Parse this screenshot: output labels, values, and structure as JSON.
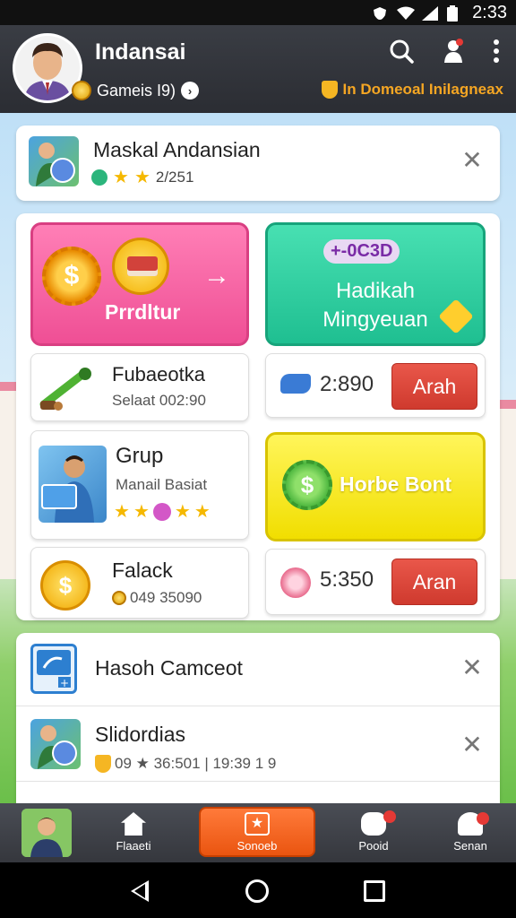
{
  "status_bar": {
    "time": "2:33"
  },
  "header": {
    "title": "Indansai",
    "subtitle": "Gameis I9)",
    "link": "In Domeoal Inilagneax"
  },
  "card1": {
    "title": "Maskal Andansian",
    "meta": "2/251"
  },
  "tiles": {
    "pink_label": "Prrdltur",
    "teal_code": "+-0C3D",
    "teal_label_1": "Hadikah",
    "teal_label_2": "Mingyeuan",
    "yellow_label": "Horbe Bont"
  },
  "rows": {
    "fubaeotka_title": "Fubaeotka",
    "fubaeotka_sub": "Selaat 002:90",
    "value1": "2:890",
    "button1": "Arah",
    "grup_title": "Grup",
    "grup_sub": "Manail Basiat",
    "falack_title": "Falack",
    "falack_sub": "049 35090",
    "value2": "5:350",
    "button2": "Aran"
  },
  "list": {
    "row1_title": "Hasoh Camceot",
    "row2_title": "Slidordias",
    "row2_meta": "09 ★ 36:501 | 19:39 1 9"
  },
  "bottom_nav": {
    "home": "Flaaeti",
    "active": "Sonoeb",
    "pool": "Pooid",
    "senan": "Senan"
  },
  "colors": {
    "pink": "#ef4f95",
    "teal": "#1fbf91",
    "yellow": "#f1de00",
    "red_button": "#cf3a2e",
    "orange_active": "#ea5510"
  }
}
